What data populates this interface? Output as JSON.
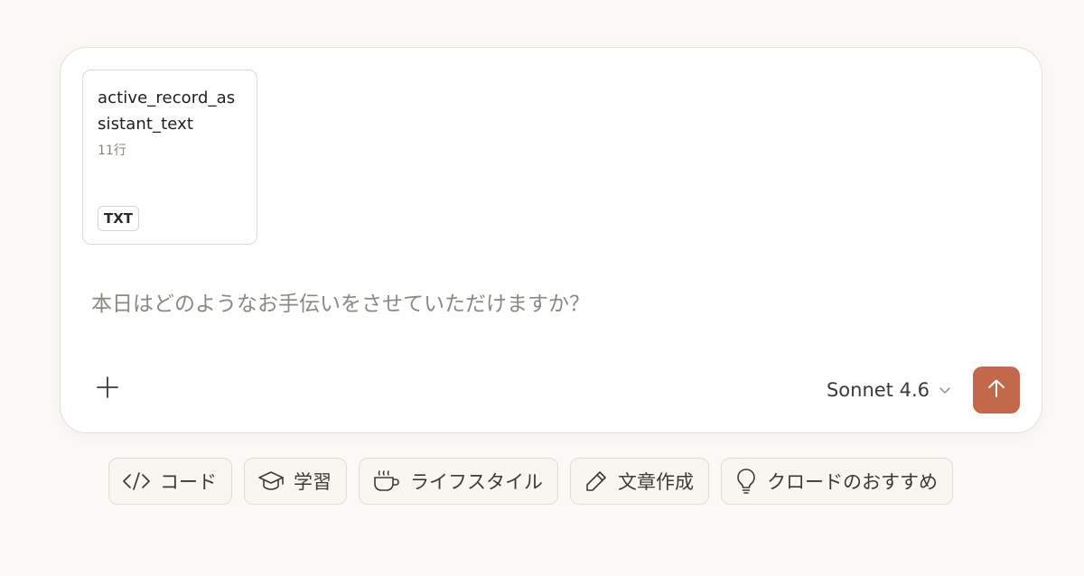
{
  "attachment": {
    "file_name": "active_record_assistant_text",
    "meta": "11行",
    "badge": "TXT"
  },
  "composer": {
    "placeholder": "本日はどのようなお手伝いをさせていただけますか？",
    "model_label": "Sonnet 4.6",
    "icons": {
      "add": "plus-icon",
      "model": "chevron-down-icon",
      "send": "arrow-up-icon"
    }
  },
  "suggestions": [
    {
      "label": "コード",
      "icon": "code-icon"
    },
    {
      "label": "学習",
      "icon": "graduation-cap-icon"
    },
    {
      "label": "ライフスタイル",
      "icon": "coffee-cup-icon"
    },
    {
      "label": "文章作成",
      "icon": "pencil-icon"
    },
    {
      "label": "クロードのおすすめ",
      "icon": "lightbulb-icon"
    }
  ],
  "colors": {
    "background": "#faf9f5",
    "accent": "#c3694b"
  }
}
